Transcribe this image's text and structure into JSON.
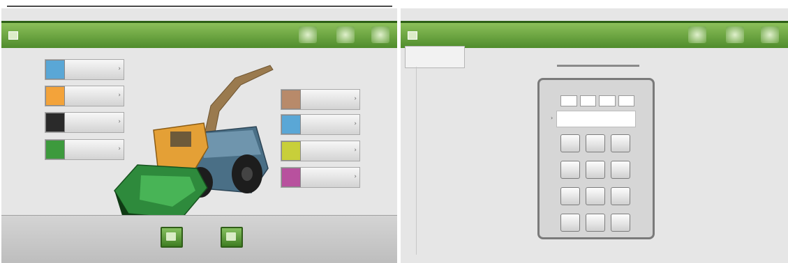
{
  "left_screen": {
    "title": "",
    "menu": [
      {
        "label": "",
        "icon": "info-icon",
        "color": "#5aa7d6"
      },
      {
        "label": "",
        "icon": "machine-icon",
        "color": "#f3a33a"
      },
      {
        "label": "",
        "icon": "sensor-icon",
        "color": "#2a2a2a"
      },
      {
        "label": "",
        "icon": "sensor-green-icon",
        "color": "#3d9a3d"
      },
      {
        "label": "",
        "icon": "settings-icon",
        "color": "#b88a6a"
      },
      {
        "label": "",
        "icon": "display-icon",
        "color": "#5aa7d6"
      },
      {
        "label": "",
        "icon": "tool-icon",
        "color": "#c8cf3a"
      },
      {
        "label": "",
        "icon": "service-icon",
        "color": "#b8519e"
      }
    ],
    "bottom_buttons": [
      {
        "label": ""
      },
      {
        "label": ""
      }
    ]
  },
  "right_screen": {
    "title": "",
    "user_box_text": "",
    "pin_title": "",
    "pin_digits": [
      "",
      "",
      "",
      ""
    ],
    "keys": [
      "",
      "",
      "",
      "",
      "",
      "",
      "",
      "",
      "",
      "",
      "",
      ""
    ]
  },
  "colors": {
    "accent_green": "#4f8c2c",
    "panel_gray": "#e6e6e6"
  }
}
